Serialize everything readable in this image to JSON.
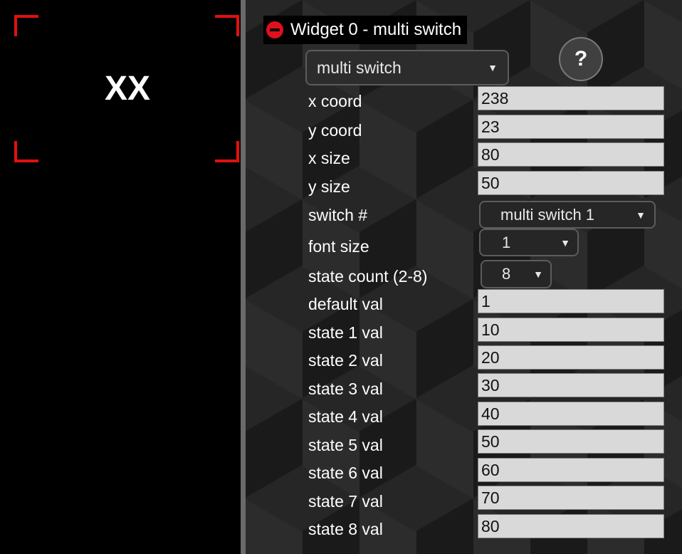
{
  "preview": {
    "widget_text": "XX"
  },
  "editor": {
    "header_title": "Widget 0 - multi switch",
    "type_select": "multi switch",
    "help_label": "?",
    "fields": [
      {
        "label": "x coord",
        "value": "238"
      },
      {
        "label": "y coord",
        "value": "23"
      },
      {
        "label": "x size",
        "value": "80"
      },
      {
        "label": "y size",
        "value": "50"
      },
      {
        "label": "switch #",
        "value": "multi switch 1"
      },
      {
        "label": "font size",
        "value": "1"
      },
      {
        "label": "state count (2-8)",
        "value": "8"
      },
      {
        "label": "default val",
        "value": "1"
      },
      {
        "label": "state 1 val",
        "value": "10"
      },
      {
        "label": "state 2 val",
        "value": "20"
      },
      {
        "label": "state 3 val",
        "value": "30"
      },
      {
        "label": "state 4 val",
        "value": "40"
      },
      {
        "label": "state 5 val",
        "value": "50"
      },
      {
        "label": "state 6 val",
        "value": "60"
      },
      {
        "label": "state 7 val",
        "value": "70"
      },
      {
        "label": "state 8 val",
        "value": "80"
      }
    ]
  },
  "colors": {
    "accent_red": "#e0101c",
    "preview_bg": "#000000",
    "input_bg": "#d9d9d9"
  },
  "icons": {
    "collapse": "minus-circle-icon",
    "help": "question-icon",
    "dropdown": "triangle-down-icon"
  }
}
